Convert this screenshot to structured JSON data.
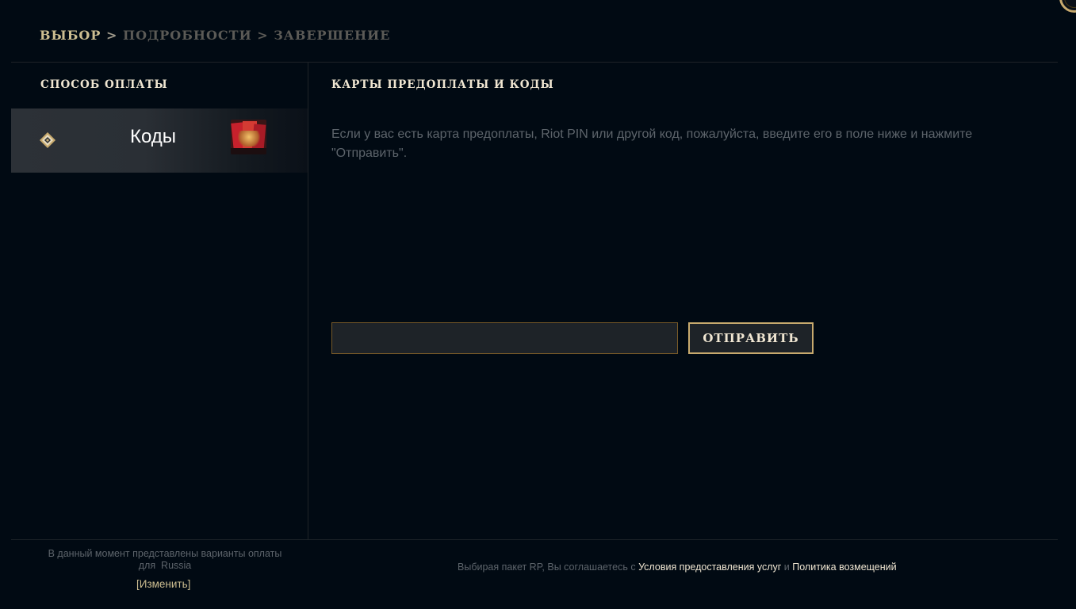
{
  "breadcrumb": {
    "step1": "ВЫБОР",
    "sep1": ">",
    "step2": "ПОДРОБНОСТИ",
    "sep2": ">",
    "step3": "ЗАВЕРШЕНИЕ"
  },
  "sidebar": {
    "title": "СПОСОБ ОПЛАТЫ",
    "items": [
      {
        "label": "Коды",
        "icon": "diamond-coin-icon",
        "thumbnail": "prepaid-card-thumbnail",
        "selected": true
      }
    ]
  },
  "main": {
    "title": "КАРТЫ ПРЕДОПЛАТЫ И КОДЫ",
    "description": "Если у вас есть карта предоплаты, Riot PIN или другой код, пожалуйста, введите его в поле ниже и нажмите \"Отправить\".",
    "code_input": {
      "value": "",
      "placeholder": ""
    },
    "submit_label": "ОТПРАВИТЬ"
  },
  "footer": {
    "region_text_line1": "В данный момент представлены варианты оплаты",
    "region_text_line2": "для  Russia",
    "change_link": "[Изменить]",
    "agreement_prefix": "Выбирая пакет RP, Вы соглашаетесь с",
    "terms_link": "Условия предоставления услуг",
    "and": "и",
    "refund_link": "Политика возмещений"
  },
  "colors": {
    "background": "#010a13",
    "gold": "#c8aa6e",
    "gold_light": "#f0e6d2",
    "muted_text": "#5d646b"
  }
}
